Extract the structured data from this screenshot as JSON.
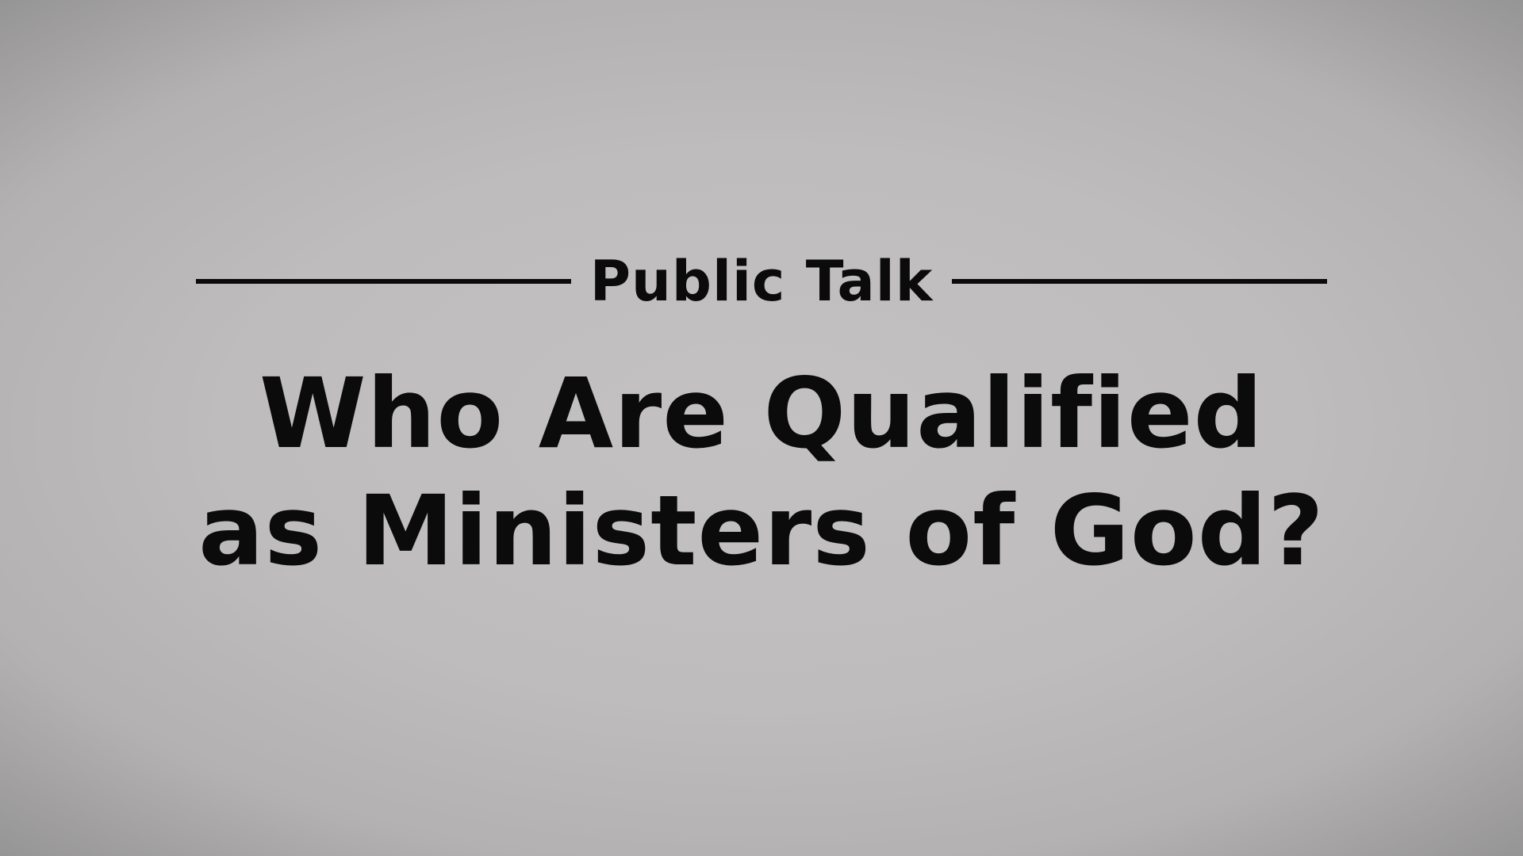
{
  "slide": {
    "kicker": "Public Talk",
    "title_lines": [
      "Who Are Qualified",
      "as Ministers of God?"
    ]
  },
  "colors": {
    "text": "#0b0b0b",
    "background_center": "#c3c1c1",
    "background_edge": "#8f8e8e"
  }
}
